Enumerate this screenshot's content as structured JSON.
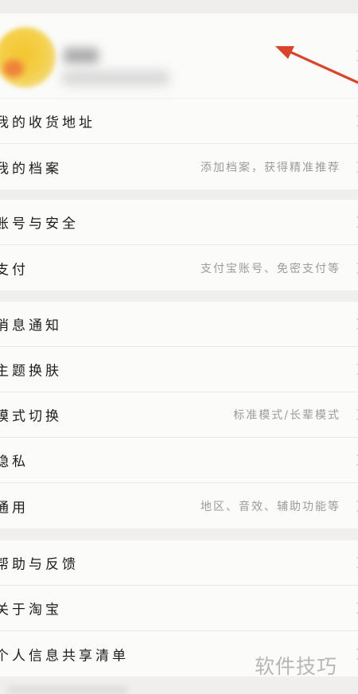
{
  "profile": {
    "chevron_icon": "chevron-right-icon"
  },
  "groups": [
    {
      "rows": [
        {
          "label": "我的收货地址",
          "hint": ""
        },
        {
          "label": "我的档案",
          "hint": "添加档案，获得精准推荐"
        }
      ]
    },
    {
      "rows": [
        {
          "label": "账号与安全",
          "hint": ""
        },
        {
          "label": "支付",
          "hint": "支付宝账号、免密支付等"
        }
      ]
    },
    {
      "rows": [
        {
          "label": "消息通知",
          "hint": ""
        },
        {
          "label": "主题换肤",
          "hint": ""
        },
        {
          "label": "模式切换",
          "hint": "标准模式/长辈模式"
        },
        {
          "label": "隐私",
          "hint": ""
        },
        {
          "label": "通用",
          "hint": "地区、音效、辅助功能等"
        }
      ]
    },
    {
      "rows": [
        {
          "label": "帮助与反馈",
          "hint": ""
        },
        {
          "label": "关于淘宝",
          "hint": ""
        },
        {
          "label": "个人信息共享清单",
          "hint": ""
        }
      ]
    }
  ],
  "watermark": "软件技巧",
  "colors": {
    "arrow": "#d8442c",
    "background": "#f0efee",
    "card": "#fbfbfa"
  }
}
